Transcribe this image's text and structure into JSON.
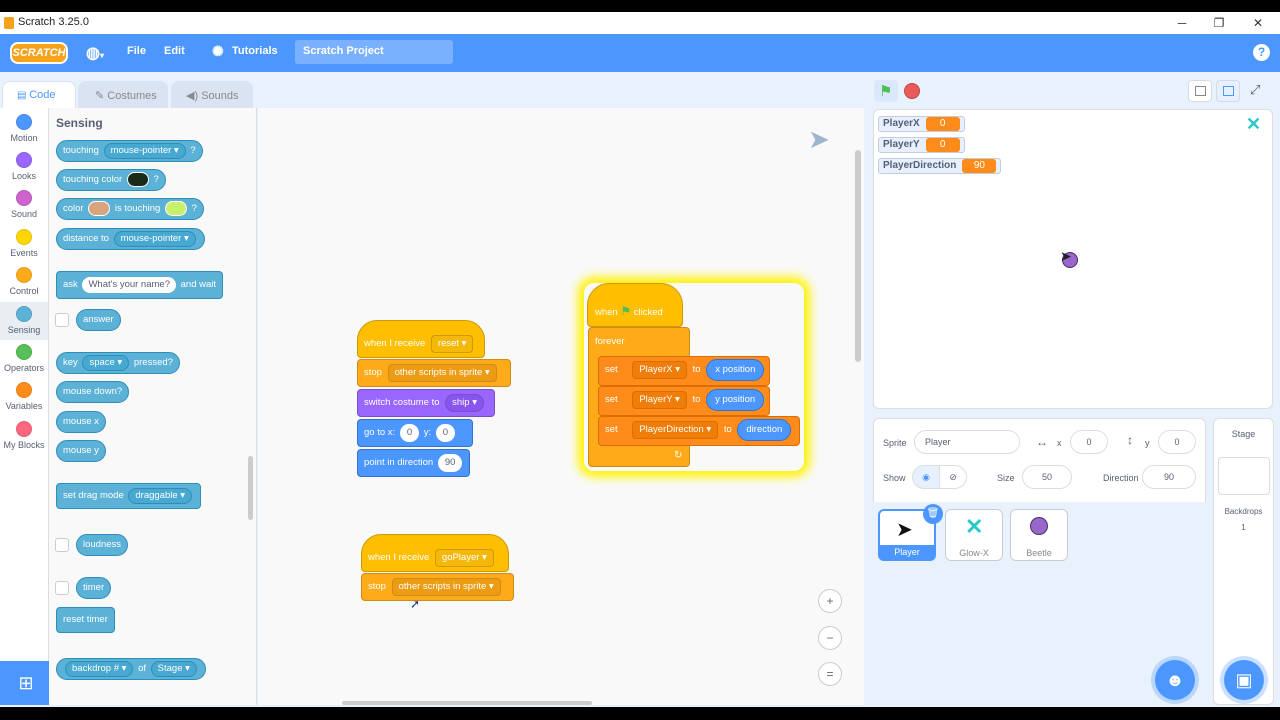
{
  "window": {
    "title": "Scratch 3.25.0",
    "controls": [
      "─",
      "❐",
      "✕"
    ]
  },
  "menubar": {
    "logo": "SCRATCH",
    "file": "File",
    "edit": "Edit",
    "tutorials": "Tutorials",
    "project_title": "Scratch Project",
    "help": "?"
  },
  "tabs": {
    "code": "Code",
    "costumes": "Costumes",
    "sounds": "Sounds"
  },
  "categories": [
    {
      "label": "Motion",
      "color": "#4c97ff"
    },
    {
      "label": "Looks",
      "color": "#9966ff"
    },
    {
      "label": "Sound",
      "color": "#cf63cf"
    },
    {
      "label": "Events",
      "color": "#ffd500"
    },
    {
      "label": "Control",
      "color": "#ffab19"
    },
    {
      "label": "Sensing",
      "color": "#5cb1d6"
    },
    {
      "label": "Operators",
      "color": "#59c059"
    },
    {
      "label": "Variables",
      "color": "#ff8c1a"
    },
    {
      "label": "My Blocks",
      "color": "#ff6680"
    }
  ],
  "palette": {
    "heading": "Sensing",
    "touching": {
      "label": "touching",
      "menu": "mouse-pointer",
      "q": "?"
    },
    "touching_color": {
      "label": "touching color",
      "swatch": "#1c2a1c",
      "q": "?"
    },
    "color_touching": {
      "label1": "color",
      "label2": "is touching",
      "swatch1": "#d9a47d",
      "swatch2": "#c8f06a",
      "q": "?"
    },
    "distance": {
      "label": "distance to",
      "menu": "mouse-pointer"
    },
    "ask": {
      "label": "ask",
      "input": "What's your name?",
      "suffix": "and wait"
    },
    "answer": "answer",
    "key_pressed": {
      "label": "key",
      "menu": "space",
      "suffix": "pressed?"
    },
    "mouse_down": "mouse down?",
    "mouse_x": "mouse x",
    "mouse_y": "mouse y",
    "drag_mode": {
      "label": "set drag mode",
      "menu": "draggable"
    },
    "loudness": "loudness",
    "timer": "timer",
    "reset_timer": "reset timer",
    "backdrop": {
      "menu": "backdrop #",
      "of": "of",
      "menu2": "Stage"
    }
  },
  "scripts": {
    "script1": {
      "when_receive": "when I receive",
      "message": "reset",
      "stop": "stop",
      "stop_option": "other scripts in sprite",
      "switch_costume": "switch costume to",
      "costume": "ship",
      "goto": "go to x:",
      "x": "0",
      "y_label": "y:",
      "y": "0",
      "point_dir": "point in direction",
      "dir": "90"
    },
    "script2": {
      "when": "when",
      "clicked": "clicked",
      "forever": "forever",
      "set": "set",
      "to": "to",
      "var1": "PlayerX",
      "rep1": "x position",
      "var2": "PlayerY",
      "rep2": "y position",
      "var3": "PlayerDirection",
      "rep3": "direction"
    },
    "script3": {
      "when_receive": "when I receive",
      "message": "goPlayer",
      "stop": "stop",
      "stop_option": "other scripts in sprite"
    },
    "zoom_in": "+",
    "zoom_out": "−",
    "zoom_reset": "="
  },
  "stage": {
    "monitors": [
      {
        "name": "PlayerX",
        "value": "0"
      },
      {
        "name": "PlayerY",
        "value": "0"
      },
      {
        "name": "PlayerDirection",
        "value": "90"
      }
    ]
  },
  "sprite_info": {
    "sprite_label": "Sprite",
    "sprite_name": "Player",
    "x_label": "x",
    "x": "0",
    "y_label": "y",
    "y": "0",
    "show_label": "Show",
    "size_label": "Size",
    "size": "50",
    "direction_label": "Direction",
    "direction": "90"
  },
  "sprites": [
    {
      "name": "Player",
      "selected": true
    },
    {
      "name": "Glow-X",
      "selected": false
    },
    {
      "name": "Beetle",
      "selected": false
    }
  ],
  "stage_pane": {
    "title": "Stage",
    "backdrops_label": "Backdrops",
    "backdrops_count": "1"
  }
}
